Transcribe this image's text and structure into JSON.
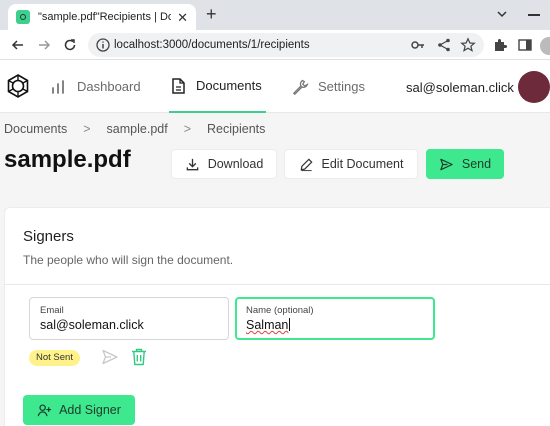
{
  "browser": {
    "tab_title": "\"sample.pdf\"Recipients | Docu",
    "new_tab": "+",
    "url": "localhost:3000/documents/1/recipients",
    "close": "✕"
  },
  "header": {
    "nav": [
      {
        "label": "Dashboard",
        "icon": "bar-chart-icon"
      },
      {
        "label": "Documents",
        "icon": "document-icon",
        "active": true
      },
      {
        "label": "Settings",
        "icon": "wrench-icon"
      }
    ],
    "user_email": "sal@soleman.click"
  },
  "breadcrumb": [
    "Documents",
    "sample.pdf",
    "Recipients"
  ],
  "breadcrumb_sep": ">",
  "page": {
    "title": "sample.pdf",
    "actions": {
      "download": "Download",
      "edit": "Edit Document",
      "send": "Send"
    }
  },
  "signers": {
    "title": "Signers",
    "subtitle": "The people who will sign the document.",
    "rows": [
      {
        "email_label": "Email",
        "email_value": "sal@soleman.click",
        "name_label": "Name (optional)",
        "name_value": "Salman",
        "status": "Not Sent"
      }
    ],
    "add_label": "Add Signer"
  },
  "colors": {
    "accent": "#3ee88e",
    "badge": "#fff28a",
    "avatar": "#6d2a3a"
  }
}
